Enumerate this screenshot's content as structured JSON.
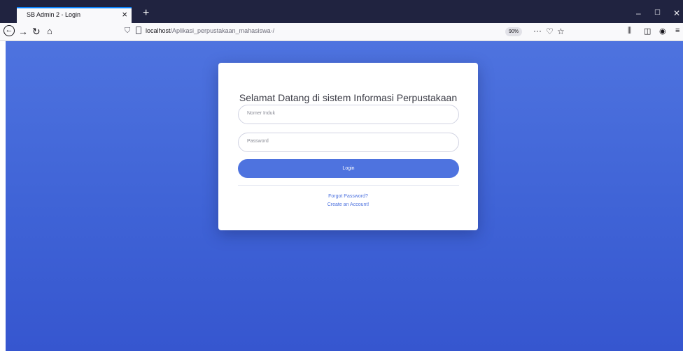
{
  "browser": {
    "tab_title": "SB Admin 2 - Login",
    "tab_close": "×",
    "new_tab": "+",
    "url_host": "localhost",
    "url_path": "/Aplikasi_perpustakaan_mahasiswa-/",
    "zoom": "90%",
    "page_actions": "···",
    "window_minimize": "–",
    "window_maximize": "☐",
    "window_close": "✕",
    "icons": {
      "back": "back-arrow-icon",
      "forward": "forward-arrow-icon",
      "reload": "reload-icon",
      "home": "home-icon",
      "shield": "tracking-protection-icon",
      "page": "page-icon",
      "pocket": "pocket-icon",
      "bookmark": "star-icon",
      "library": "library-icon",
      "sidebar": "sidebar-icon",
      "account": "account-icon",
      "menu": "hamburger-menu-icon"
    }
  },
  "login": {
    "title": "Selamat Datang di sistem Informasi Perpustakaan",
    "username_placeholder": "Nomer Induk",
    "password_placeholder": "Password",
    "login_button": "Login",
    "forgot_link": "Forgot Password?",
    "register_link": "Create an Account!"
  },
  "colors": {
    "primary": "#4e73df",
    "tabbar": "#202340",
    "card": "#ffffff"
  }
}
